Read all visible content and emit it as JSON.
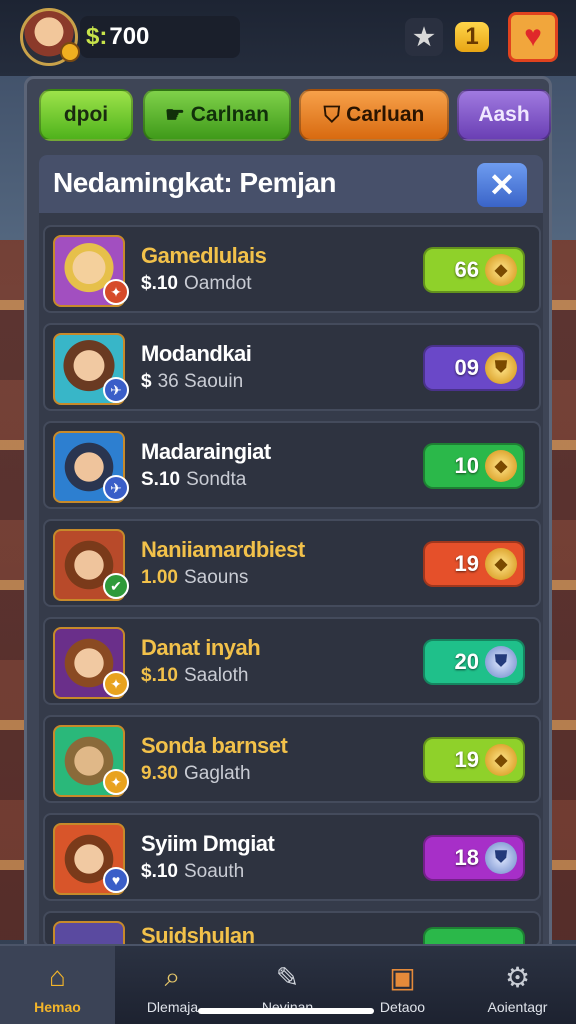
{
  "header": {
    "currency_symbol": "$:",
    "currency_value": "700",
    "icons": [
      "star-icon",
      "gold-ticket-icon",
      "heart-gift-icon"
    ],
    "gold_label": "1"
  },
  "tabs": [
    {
      "label": "dpoi",
      "icon": ""
    },
    {
      "label": "Carlnan",
      "icon": "pointing-hand-icon"
    },
    {
      "label": "Carluan",
      "icon": "shield-icon"
    },
    {
      "label": "Aash",
      "icon": ""
    }
  ],
  "panel": {
    "title": "Nedamingkat: Pemjan",
    "close_label": "✕"
  },
  "rows": [
    {
      "name": "Gamedlulais",
      "price": "$.10",
      "detail": "Oamdot",
      "value": "66",
      "name_color": "#f2c14a",
      "pill": "#8fd12a",
      "coin": "gold",
      "portrait": "#a24fc0",
      "badge": "#d64a2a"
    },
    {
      "name": "Modandkai",
      "price": "$",
      "detail": "36 Saouin",
      "value": "09",
      "name_color": "#ffffff",
      "pill": "#6a48c8",
      "coin": "gold",
      "portrait": "#38b6c8",
      "badge": "#3a5ec8"
    },
    {
      "name": "Madaraingiat",
      "price": "S.10",
      "detail": "Sondta",
      "value": "10",
      "name_color": "#ffffff",
      "pill": "#2bb84a",
      "coin": "gold",
      "portrait": "#2d7fd0",
      "badge": "#3a5ec8"
    },
    {
      "name": "Naniiamardbiest",
      "price": "1.00",
      "detail": "Saouns",
      "value": "19",
      "name_color": "#f2c14a",
      "pill": "#e5502a",
      "coin": "gold",
      "portrait": "#b84a2a",
      "badge": "#2f9a3a"
    },
    {
      "name": "Danat inyah",
      "price": "$.10",
      "detail": "Saaloth",
      "value": "20",
      "name_color": "#f2c14a",
      "pill": "#1fc08a",
      "coin": "blue",
      "portrait": "#6a2f8a",
      "badge": "#e8a21e"
    },
    {
      "name": "Sonda barnset",
      "price": "9.30",
      "detail": "Gaglath",
      "value": "19",
      "name_color": "#f2c14a",
      "pill": "#8fd12a",
      "coin": "gold",
      "portrait": "#2ab87a",
      "badge": "#e8a21e"
    },
    {
      "name": "Syiim Dmgiat",
      "price": "$.10",
      "detail": "Soauth",
      "value": "18",
      "name_color": "#ffffff",
      "pill": "#a72fc8",
      "coin": "blue",
      "portrait": "#d8552a",
      "badge": "#3a5ec8"
    },
    {
      "name": "Suidshulan",
      "price": "",
      "detail": "",
      "value": "",
      "name_color": "#f2c14a",
      "pill": "#2bb84a",
      "coin": "gold",
      "portrait": "#5a4aa0",
      "badge": "#3a5ec8"
    }
  ],
  "nav": [
    {
      "label": "Hemao",
      "icon": "home-icon",
      "active": true
    },
    {
      "label": "Dlemaja",
      "icon": "magnifier-icon",
      "active": false
    },
    {
      "label": "Nevinan",
      "icon": "pencil-icon",
      "active": false
    },
    {
      "label": "Detaoo",
      "icon": "card-icon",
      "active": false
    },
    {
      "label": "Aoientagr",
      "icon": "settings-icon",
      "active": false
    }
  ]
}
